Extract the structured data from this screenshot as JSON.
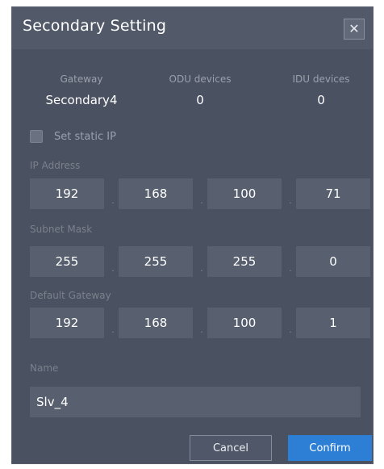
{
  "dialog": {
    "title": "Secondary Setting",
    "close_icon": "close-icon"
  },
  "stats": [
    {
      "label": "Gateway",
      "value": "Secondary4"
    },
    {
      "label": "ODU devices",
      "value": "0"
    },
    {
      "label": "IDU devices",
      "value": "0"
    }
  ],
  "static_ip": {
    "label": "Set static IP",
    "checked": false
  },
  "ip_address": {
    "label": "IP Address",
    "octets": [
      "192",
      "168",
      "100",
      "71"
    ]
  },
  "subnet_mask": {
    "label": "Subnet Mask",
    "octets": [
      "255",
      "255",
      "255",
      "0"
    ]
  },
  "default_gateway": {
    "label": "Default Gateway",
    "octets": [
      "192",
      "168",
      "100",
      "1"
    ]
  },
  "name": {
    "label": "Name",
    "value": "Slv_4"
  },
  "separator": ".",
  "buttons": {
    "cancel": "Cancel",
    "confirm": "Confirm"
  },
  "colors": {
    "dialog_bg": "#4a5160",
    "field_bg": "#585f6e",
    "accent": "#2d7fd6"
  }
}
